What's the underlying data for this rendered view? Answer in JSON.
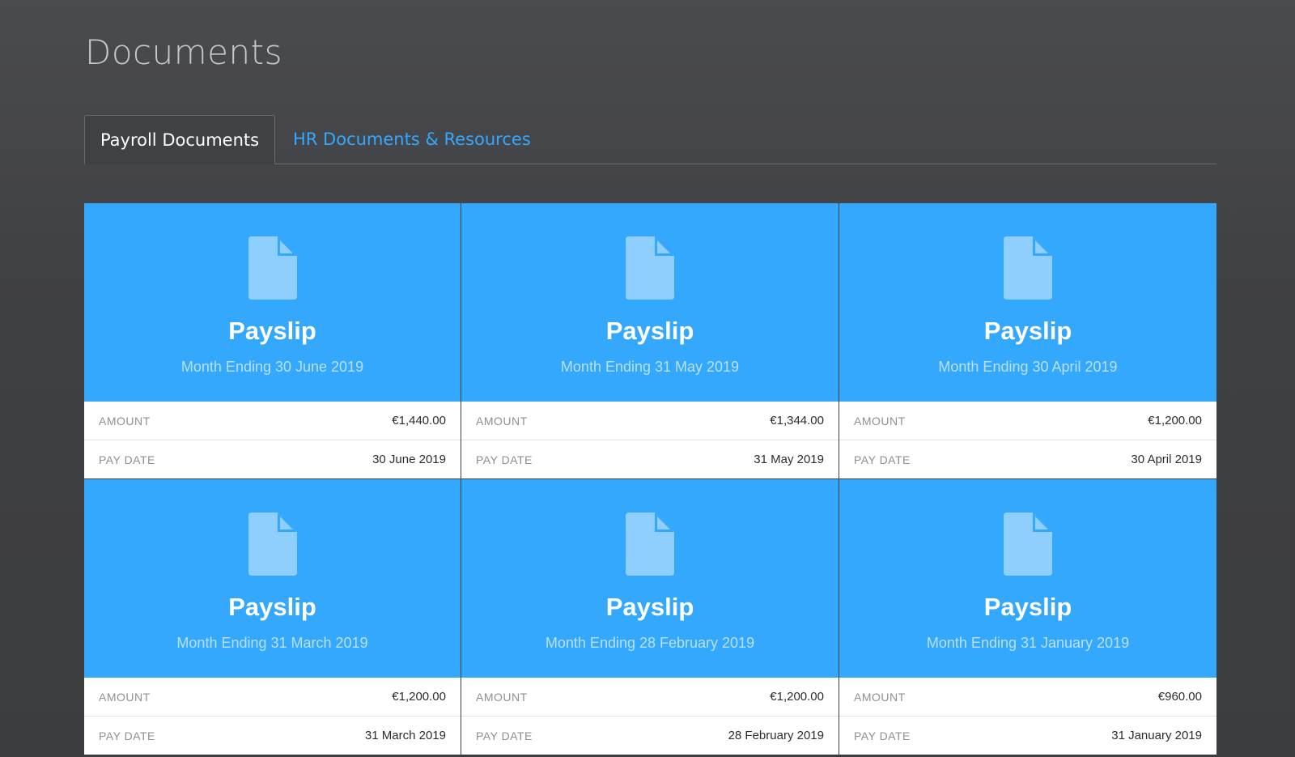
{
  "page": {
    "title": "Documents"
  },
  "tabs": [
    {
      "label": "Payroll Documents",
      "active": true
    },
    {
      "label": "HR Documents & Resources",
      "active": false
    }
  ],
  "colors": {
    "accent": "#33a8fd",
    "link": "#33a8ff",
    "background": "#3f4043"
  },
  "labels": {
    "amount": "AMOUNT",
    "pay_date": "PAY DATE"
  },
  "documents": [
    {
      "icon": "document-icon",
      "title": "Payslip",
      "subtitle": "Month Ending 30 June 2019",
      "amount": "€1,440.00",
      "pay_date": "30 June 2019"
    },
    {
      "icon": "document-icon",
      "title": "Payslip",
      "subtitle": "Month Ending 31 May 2019",
      "amount": "€1,344.00",
      "pay_date": "31 May 2019"
    },
    {
      "icon": "document-icon",
      "title": "Payslip",
      "subtitle": "Month Ending 30 April 2019",
      "amount": "€1,200.00",
      "pay_date": "30 April 2019"
    },
    {
      "icon": "document-icon",
      "title": "Payslip",
      "subtitle": "Month Ending 31 March 2019",
      "amount": "€1,200.00",
      "pay_date": "31 March 2019"
    },
    {
      "icon": "document-icon",
      "title": "Payslip",
      "subtitle": "Month Ending 28 February 2019",
      "amount": "€1,200.00",
      "pay_date": "28 February 2019"
    },
    {
      "icon": "document-icon",
      "title": "Payslip",
      "subtitle": "Month Ending 31 January 2019",
      "amount": "€960.00",
      "pay_date": "31 January 2019"
    }
  ]
}
